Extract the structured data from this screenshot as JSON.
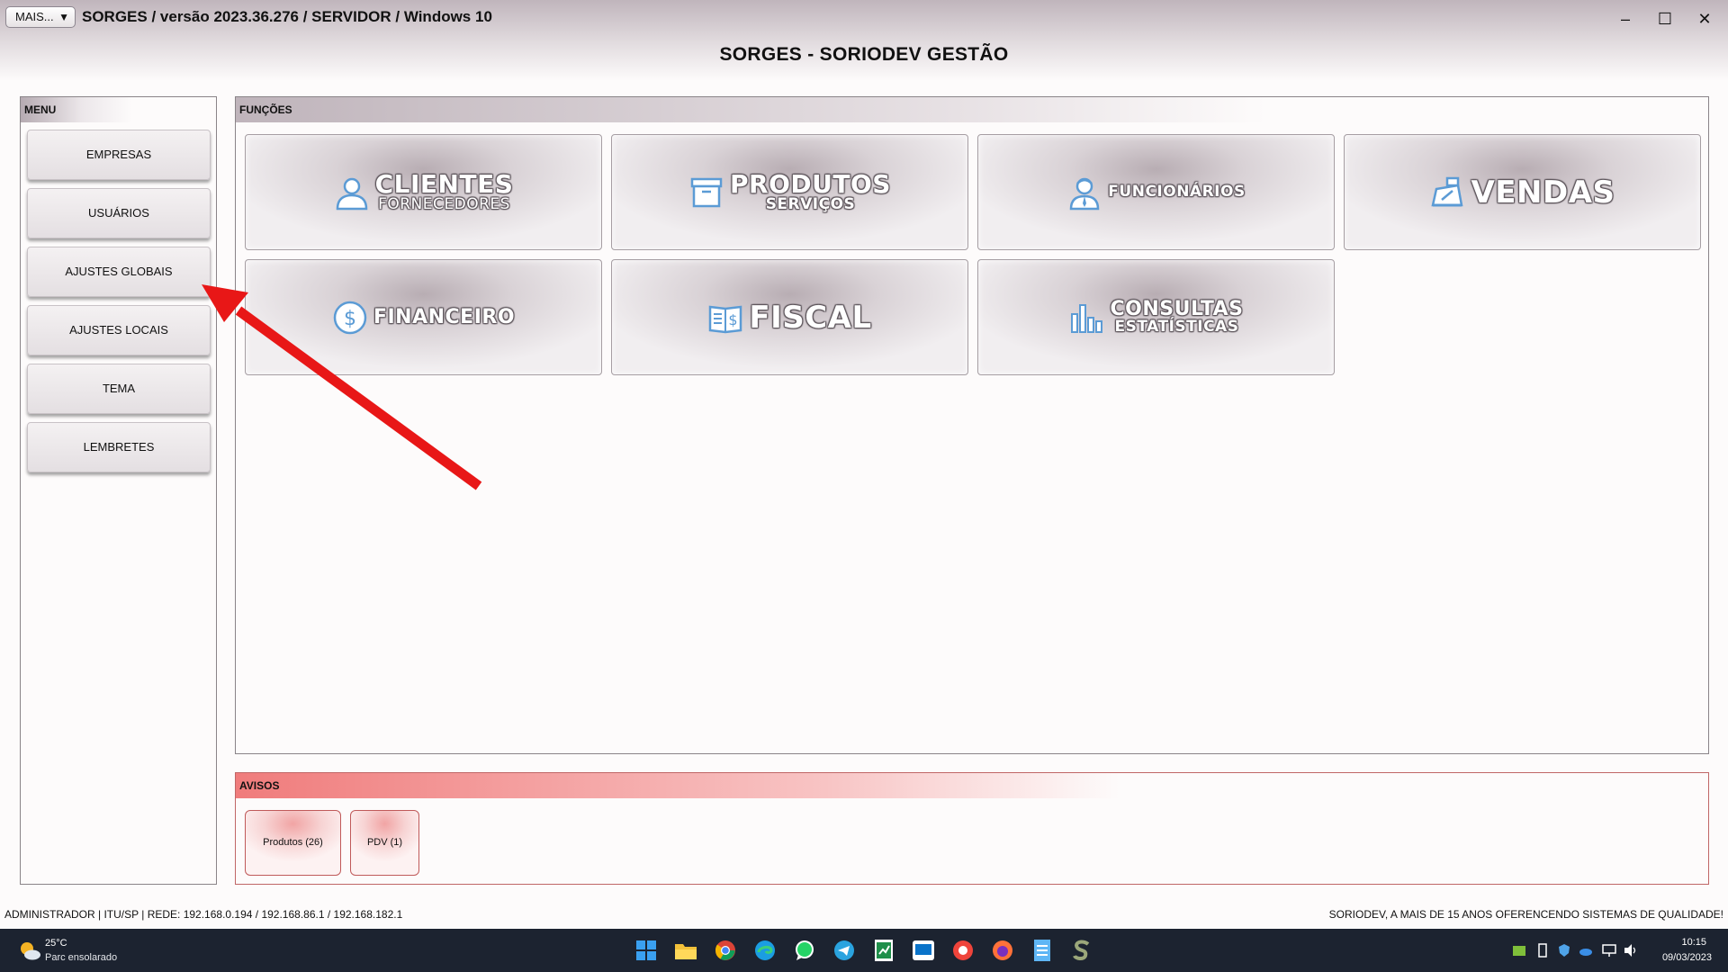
{
  "window": {
    "mais_label": "MAIS...",
    "dropdown_glyph": "▼",
    "title": "SORGES / versão 2023.36.276 / SERVIDOR / Windows 10",
    "minimize_glyph": "–",
    "maximize_glyph": "☐",
    "close_glyph": "✕"
  },
  "app_title": "SORGES - SORIODEV GESTÃO",
  "menu": {
    "header": "MENU",
    "items": [
      {
        "label": "EMPRESAS"
      },
      {
        "label": "USUÁRIOS"
      },
      {
        "label": "AJUSTES GLOBAIS"
      },
      {
        "label": "AJUSTES LOCAIS"
      },
      {
        "label": "TEMA"
      },
      {
        "label": "LEMBRETES"
      }
    ]
  },
  "funcoes": {
    "header": "FUNÇÕES",
    "tiles": [
      {
        "title": "CLIENTES",
        "subtitle": "FORNECEDORES",
        "icon": "person-icon"
      },
      {
        "title": "PRODUTOS",
        "subtitle": "SERVIÇOS",
        "icon": "box-icon"
      },
      {
        "title": "FUNCIONÁRIOS",
        "subtitle": "",
        "icon": "employee-icon"
      },
      {
        "title": "VENDAS",
        "subtitle": "",
        "icon": "cash-register-icon"
      },
      {
        "title": "FINANCEIRO",
        "subtitle": "",
        "icon": "dollar-coin-icon"
      },
      {
        "title": "FISCAL",
        "subtitle": "",
        "icon": "invoice-book-icon"
      },
      {
        "title": "CONSULTAS",
        "subtitle": "ESTATÍSTICAS",
        "icon": "bar-chart-icon"
      }
    ]
  },
  "avisos": {
    "header": "AVISOS",
    "items": [
      {
        "label": "Produtos (26)"
      },
      {
        "label": "PDV (1)"
      }
    ]
  },
  "status": {
    "left": "ADMINISTRADOR |   ITU/SP |   REDE: 192.168.0.194 / 192.168.86.1 / 192.168.182.1",
    "right": "SORIODEV, A MAIS DE 15 ANOS OFERENCENDO SISTEMAS DE QUALIDADE!"
  },
  "taskbar": {
    "weather_temp": "25°C",
    "weather_desc": "Parc ensolarado",
    "time": "10:15",
    "date": "09/03/2023",
    "apps": [
      "start-icon",
      "file-explorer-icon",
      "chrome-icon",
      "edge-icon",
      "whatsapp-icon",
      "telegram-icon",
      "spreadsheet-icon",
      "remote-app-icon",
      "anydesk-icon",
      "firefox-icon",
      "notepad-icon",
      "sorges-app-icon"
    ]
  },
  "colors": {
    "accent_red": "#e81717",
    "avisos_red": "#f07c7c",
    "taskbar_bg": "#1c2330",
    "icon_blue": "#5b9bd5"
  }
}
